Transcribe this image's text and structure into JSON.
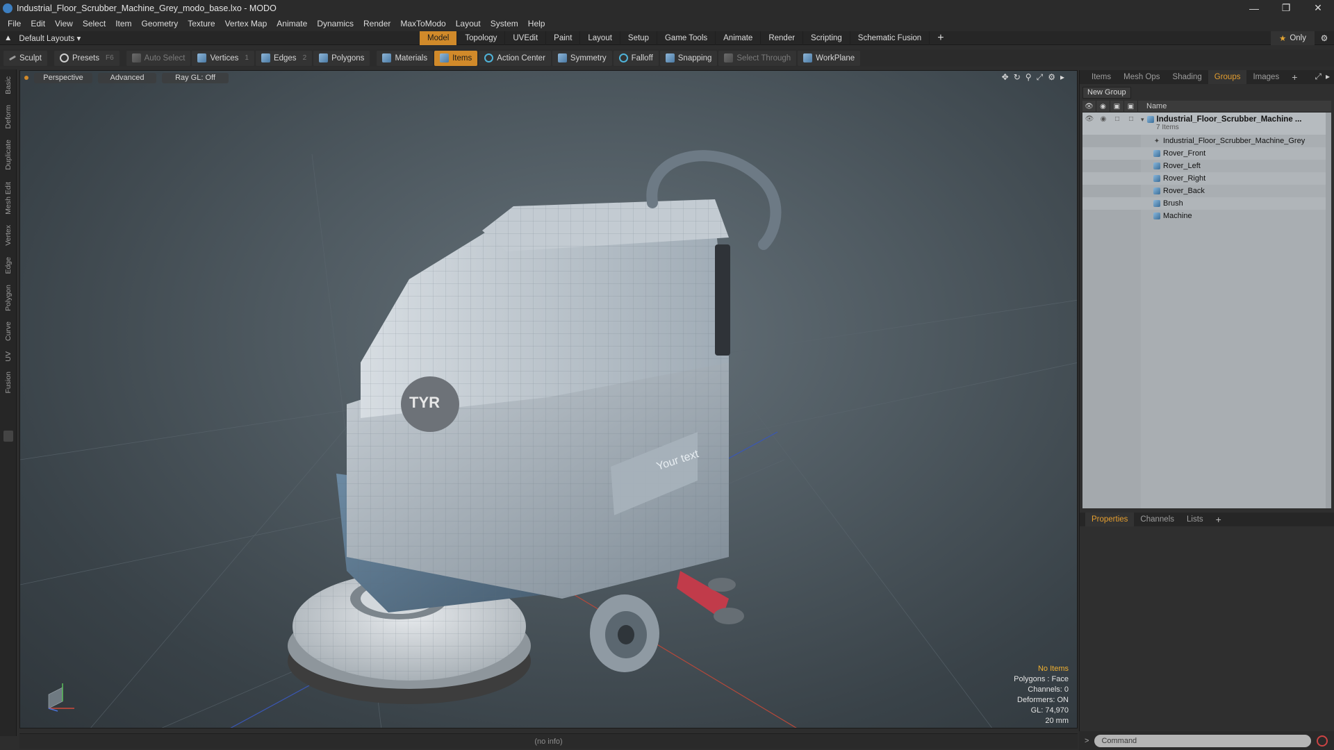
{
  "window": {
    "title": "Industrial_Floor_Scrubber_Machine_Grey_modo_base.lxo - MODO",
    "controls": [
      "minimize",
      "restore",
      "close"
    ]
  },
  "menu": [
    "File",
    "Edit",
    "View",
    "Select",
    "Item",
    "Geometry",
    "Texture",
    "Vertex Map",
    "Animate",
    "Dynamics",
    "Render",
    "MaxToModo",
    "Layout",
    "System",
    "Help"
  ],
  "layouts_label": "Default Layouts",
  "tabs": [
    "Model",
    "Topology",
    "UVEdit",
    "Paint",
    "Layout",
    "Setup",
    "Game Tools",
    "Animate",
    "Render",
    "Scripting",
    "Schematic Fusion"
  ],
  "active_tab": "Model",
  "only_label": "Only",
  "toolbar": {
    "sculpt": "Sculpt",
    "presets": "Presets",
    "presets_key": "F6",
    "auto_select": "Auto Select",
    "vertices": "Vertices",
    "vertices_key": "1",
    "edges": "Edges",
    "edges_key": "2",
    "polygons": "Polygons",
    "materials": "Materials",
    "items": "Items",
    "action_center": "Action Center",
    "symmetry": "Symmetry",
    "falloff": "Falloff",
    "snapping": "Snapping",
    "select_through": "Select Through",
    "workplane": "WorkPlane"
  },
  "left_tabs": [
    "Basic",
    "Deform",
    "Duplicate",
    "Mesh Edit",
    "Vertex",
    "Edge",
    "Polygon",
    "Curve",
    "UV",
    "Fusion"
  ],
  "viewport": {
    "view": "Perspective",
    "mode": "Advanced",
    "raygl": "Ray GL: Off",
    "stats": {
      "selection": "No Items",
      "polygons": "Polygons : Face",
      "channels": "Channels: 0",
      "deformers": "Deformers: ON",
      "gl": "GL: 74,970",
      "unit": "20 mm"
    },
    "decal_text": "Your text",
    "brand_text": "TYR"
  },
  "right_panel": {
    "tabs": [
      "Items",
      "Mesh Ops",
      "Shading",
      "Groups",
      "Images"
    ],
    "active_tab": "Groups",
    "new_group": "New Group",
    "name_header": "Name",
    "group": {
      "title": "Industrial_Floor_Scrubber_Machine ...",
      "count": "7 Items"
    },
    "items": [
      {
        "label": "Industrial_Floor_Scrubber_Machine_Grey",
        "icon": "locator-icon"
      },
      {
        "label": "Rover_Front",
        "icon": "mesh-icon"
      },
      {
        "label": "Rover_Left",
        "icon": "mesh-icon"
      },
      {
        "label": "Rover_Right",
        "icon": "mesh-icon"
      },
      {
        "label": "Rover_Back",
        "icon": "mesh-icon"
      },
      {
        "label": "Brush",
        "icon": "mesh-icon"
      },
      {
        "label": "Machine",
        "icon": "mesh-icon"
      }
    ],
    "bottom_tabs": [
      "Properties",
      "Channels",
      "Lists"
    ],
    "bottom_active": "Properties"
  },
  "status": {
    "info": "(no info)",
    "command_placeholder": "Command"
  },
  "colors": {
    "accent": "#d18a2a",
    "active_tab_text": "#e69f2f"
  }
}
